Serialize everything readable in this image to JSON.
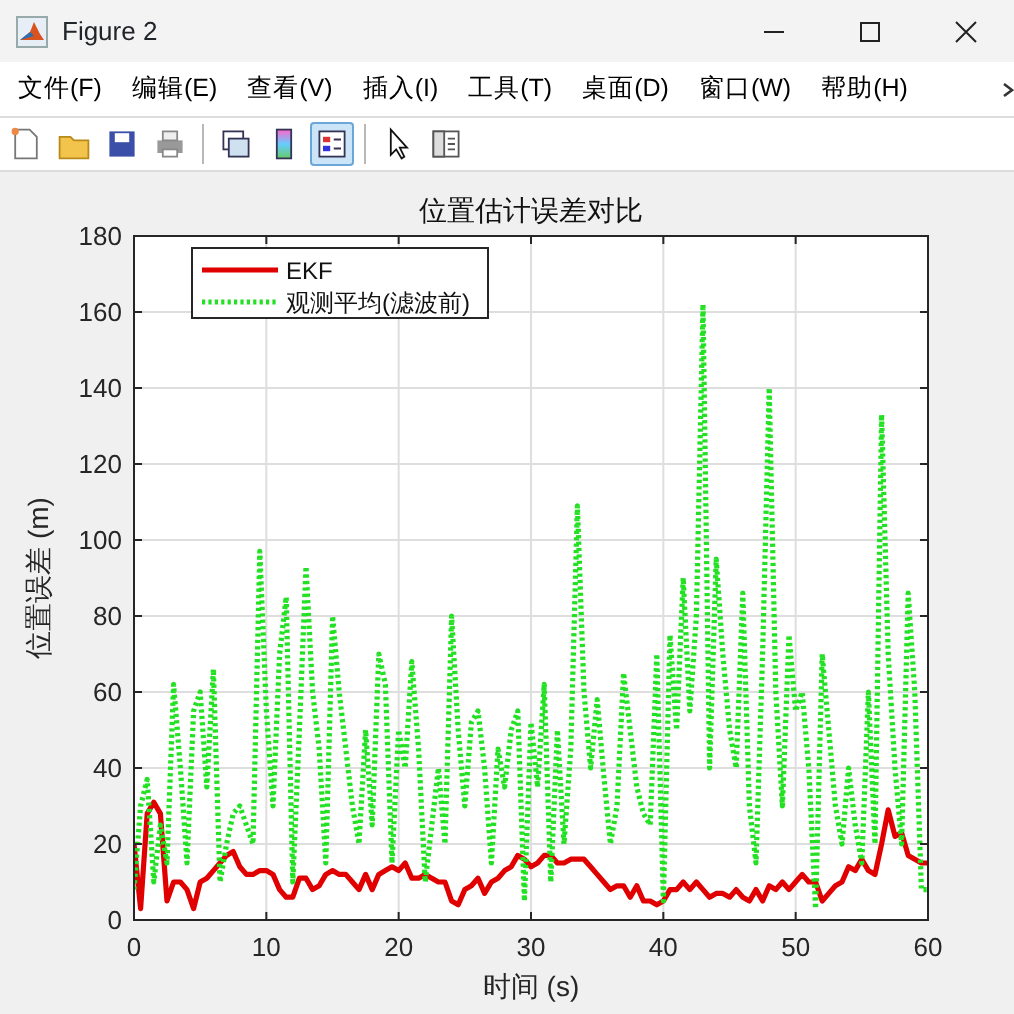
{
  "window": {
    "title": "Figure 2"
  },
  "menu": [
    "文件(F)",
    "编辑(E)",
    "查看(V)",
    "插入(I)",
    "工具(T)",
    "桌面(D)",
    "窗口(W)",
    "帮助(H)"
  ],
  "toolbar": {
    "groups": [
      [
        {
          "selected": false
        },
        {
          "selected": false
        },
        {
          "selected": false
        },
        {
          "selected": false
        }
      ],
      [
        {
          "selected": false
        },
        {
          "selected": false
        },
        {
          "selected": true
        }
      ],
      [
        {
          "selected": false
        },
        {
          "selected": false
        }
      ]
    ]
  },
  "chart_data": {
    "type": "line",
    "title": "位置估计误差对比",
    "xlabel": "时间 (s)",
    "ylabel": "位置误差 (m)",
    "x": [
      0,
      0.5,
      1,
      1.5,
      2,
      2.5,
      3,
      3.5,
      4,
      4.5,
      5,
      5.5,
      6,
      6.5,
      7,
      7.5,
      8,
      8.5,
      9,
      9.5,
      10,
      10.5,
      11,
      11.5,
      12,
      12.5,
      13,
      13.5,
      14,
      14.5,
      15,
      15.5,
      16,
      16.5,
      17,
      17.5,
      18,
      18.5,
      19,
      19.5,
      20,
      20.5,
      21,
      21.5,
      22,
      22.5,
      23,
      23.5,
      24,
      24.5,
      25,
      25.5,
      26,
      26.5,
      27,
      27.5,
      28,
      28.5,
      29,
      29.5,
      30,
      30.5,
      31,
      31.5,
      32,
      32.5,
      33,
      33.5,
      34,
      34.5,
      35,
      35.5,
      36,
      36.5,
      37,
      37.5,
      38,
      38.5,
      39,
      39.5,
      40,
      40.5,
      41,
      41.5,
      42,
      42.5,
      43,
      43.5,
      44,
      44.5,
      45,
      45.5,
      46,
      46.5,
      47,
      47.5,
      48,
      48.5,
      49,
      49.5,
      50,
      50.5,
      51,
      51.5,
      52,
      52.5,
      53,
      53.5,
      54,
      54.5,
      55,
      55.5,
      56,
      56.5,
      57,
      57.5,
      58,
      58.5,
      59,
      59.5,
      60
    ],
    "series": [
      {
        "name": "EKF",
        "color": "#e00000",
        "line_style": "solid",
        "values": [
          20,
          3,
          28,
          31,
          28,
          5,
          10,
          10,
          8,
          3,
          10,
          11,
          13,
          15,
          17,
          18,
          14,
          12,
          12,
          13,
          13,
          12,
          8,
          6,
          6,
          11,
          11,
          8,
          9,
          12,
          13,
          12,
          12,
          10,
          8,
          12,
          8,
          12,
          13,
          14,
          13,
          15,
          11,
          11,
          12,
          11,
          10,
          10,
          5,
          4,
          8,
          9,
          11,
          7,
          10,
          11,
          13,
          14,
          17,
          16,
          14,
          15,
          17,
          17,
          15,
          15,
          16,
          16,
          16,
          14,
          12,
          10,
          8,
          9,
          9,
          6,
          9,
          5,
          5,
          4,
          5,
          8,
          8,
          10,
          8,
          10,
          8,
          6,
          7,
          7,
          6,
          8,
          6,
          5,
          8,
          5,
          9,
          8,
          10,
          8,
          10,
          12,
          10,
          10,
          5,
          7,
          9,
          10,
          14,
          13,
          16,
          13,
          12,
          20,
          29,
          22,
          23,
          17,
          16,
          15,
          15
        ]
      },
      {
        "name": "观测平均(滤波前)",
        "color": "#22e022",
        "line_style": "dotted",
        "values": [
          8,
          30,
          37,
          10,
          25,
          15,
          62,
          40,
          15,
          55,
          60,
          35,
          66,
          10,
          20,
          28,
          30,
          25,
          20,
          97,
          55,
          30,
          70,
          85,
          10,
          50,
          93,
          60,
          45,
          15,
          80,
          60,
          45,
          30,
          20,
          50,
          25,
          70,
          62,
          15,
          50,
          40,
          68,
          45,
          10,
          25,
          40,
          20,
          80,
          50,
          30,
          52,
          55,
          40,
          15,
          45,
          35,
          50,
          55,
          5,
          52,
          35,
          62,
          10,
          50,
          20,
          45,
          109,
          60,
          40,
          58,
          38,
          20,
          30,
          65,
          50,
          35,
          28,
          25,
          70,
          5,
          75,
          50,
          90,
          55,
          80,
          162,
          40,
          95,
          70,
          50,
          40,
          86,
          30,
          15,
          70,
          140,
          60,
          30,
          75,
          55,
          60,
          40,
          3,
          70,
          50,
          30,
          20,
          40,
          25,
          15,
          60,
          20,
          133,
          70,
          40,
          20,
          86,
          60,
          8,
          8
        ]
      }
    ],
    "grid": true,
    "legend": true,
    "xlim": [
      0,
      60
    ],
    "ylim": [
      0,
      180
    ],
    "xticks": [
      0,
      10,
      20,
      30,
      40,
      50,
      60
    ],
    "yticks": [
      0,
      20,
      40,
      60,
      80,
      100,
      120,
      140,
      160,
      180
    ]
  }
}
